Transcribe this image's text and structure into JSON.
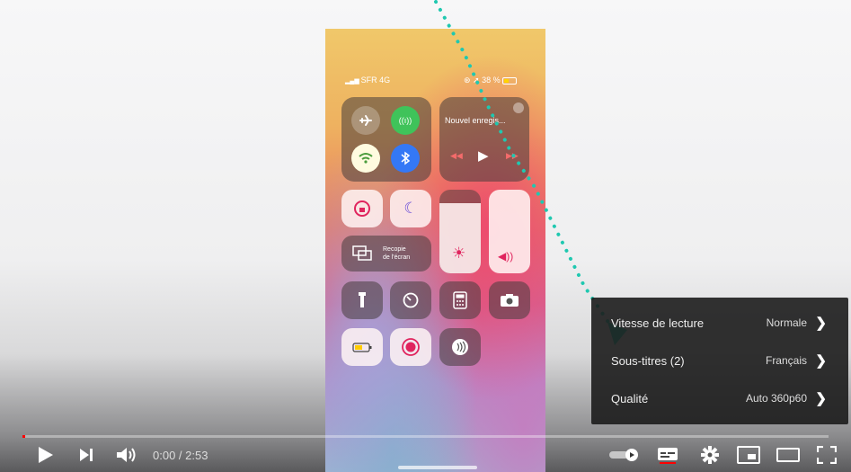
{
  "phone": {
    "carrier": "SFR 4G",
    "battery": "38 %",
    "now_playing": "Nouvel enregis...",
    "screen_mirror_label_1": "Recopie",
    "screen_mirror_label_2": "de l'écran"
  },
  "menu": {
    "items": [
      {
        "label": "Vitesse de lecture",
        "value": "Normale"
      },
      {
        "label": "Sous-titres (2)",
        "value": "Français"
      },
      {
        "label": "Qualité",
        "value": "Auto 360p60"
      }
    ]
  },
  "player": {
    "time": "0:00 / 2:53",
    "progress_fraction": 0.002,
    "accent_color": "#ff0000",
    "icons": [
      "play-icon",
      "next-icon",
      "volume-icon",
      "autoplay-toggle-icon",
      "subtitles-icon",
      "settings-gear-icon",
      "miniplayer-icon",
      "theater-mode-icon",
      "fullscreen-icon"
    ]
  }
}
